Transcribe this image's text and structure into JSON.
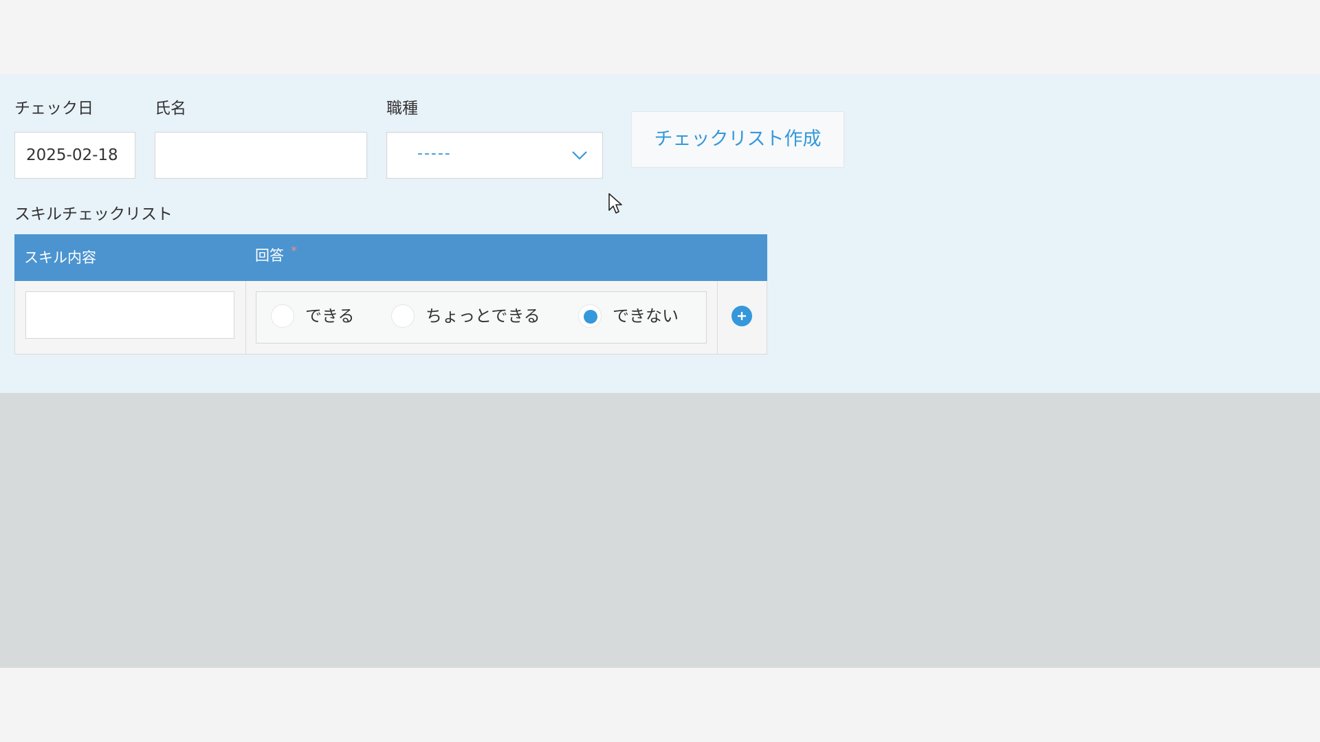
{
  "form": {
    "check_date_label": "チェック日",
    "check_date_value": "2025-02-18",
    "name_label": "氏名",
    "name_value": "",
    "job_label": "職種",
    "job_selected": "-----",
    "create_button_label": "チェックリスト作成"
  },
  "checklist": {
    "title": "スキルチェックリスト",
    "columns": [
      "スキル内容",
      "回答"
    ],
    "required_mark": "*",
    "rows": [
      {
        "skill_value": "",
        "options": [
          "できる",
          "ちょっとできる",
          "できない"
        ],
        "selected": "できない"
      }
    ]
  },
  "colors": {
    "accent": "#3498db",
    "header_bg": "#4b94d0",
    "form_bg": "#e8f2f9",
    "gray_band": "#d6dadb"
  },
  "icons": {
    "select": "chevron-down-icon",
    "add_row": "plus-circle-icon",
    "pointer": "mouse-pointer-icon"
  }
}
